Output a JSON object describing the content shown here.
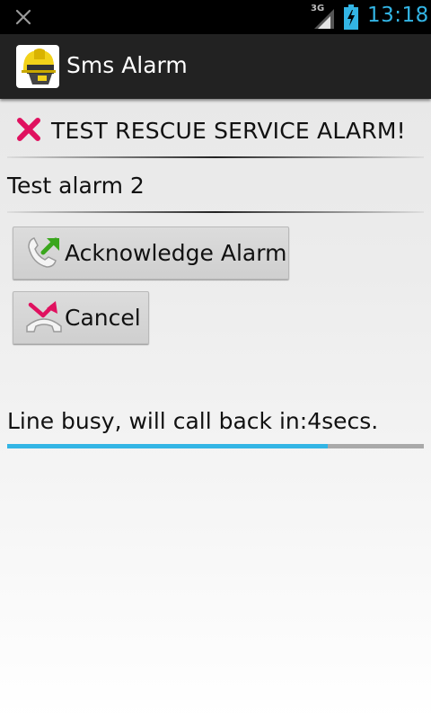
{
  "status_bar": {
    "network_type": "3G",
    "time": "13:18",
    "notification_icon": "close-icon",
    "accent_color": "#33b5e5"
  },
  "action_bar": {
    "app_icon": "firefighter-helmet-icon",
    "title": "Sms Alarm"
  },
  "alarm": {
    "icon": "red-x-icon",
    "title": "TEST RESCUE SERVICE ALARM!",
    "message": "Test alarm 2"
  },
  "buttons": {
    "acknowledge": {
      "label": "Acknowledge Alarm",
      "icon": "phone-answer-icon"
    },
    "cancel": {
      "label": "Cancel",
      "icon": "phone-hangup-icon"
    }
  },
  "callback": {
    "text": "Line busy, will call back in:",
    "value": "4secs.",
    "progress_fraction": 0.77
  }
}
